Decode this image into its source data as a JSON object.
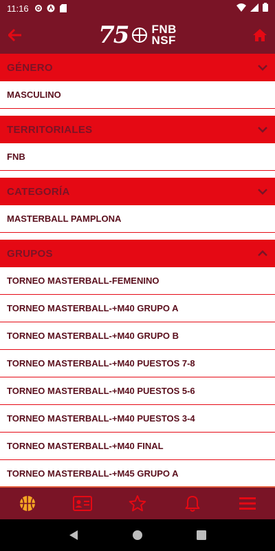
{
  "status": {
    "time": "11:16"
  },
  "logo": {
    "number": "75",
    "line1": "FNB",
    "line2": "NSF"
  },
  "sections": [
    {
      "title": "GÉNERO",
      "expanded": false,
      "items": [
        "MASCULINO"
      ]
    },
    {
      "title": "TERRITORIALES",
      "expanded": false,
      "items": [
        "FNB"
      ]
    },
    {
      "title": "CATEGORÍA",
      "expanded": false,
      "items": [
        "MASTERBALL PAMPLONA"
      ]
    },
    {
      "title": "GRUPOS",
      "expanded": true,
      "items": [
        "TORNEO MASTERBALL-FEMENINO",
        "TORNEO MASTERBALL-+M40 GRUPO A",
        "TORNEO MASTERBALL-+M40 GRUPO B",
        "TORNEO MASTERBALL-+M40 PUESTOS 7-8",
        "TORNEO MASTERBALL-+M40 PUESTOS 5-6",
        "TORNEO MASTERBALL-+M40 PUESTOS 3-4",
        "TORNEO MASTERBALL-+M40 FINAL",
        "TORNEO MASTERBALL-+M45 GRUPO A"
      ]
    }
  ],
  "colors": {
    "primary": "#7a1426",
    "accent": "#e50914",
    "active_nav": "#f5a623"
  },
  "bottom_nav": [
    "basketball-icon",
    "id-card-icon",
    "star-icon",
    "bell-icon",
    "menu-icon"
  ]
}
